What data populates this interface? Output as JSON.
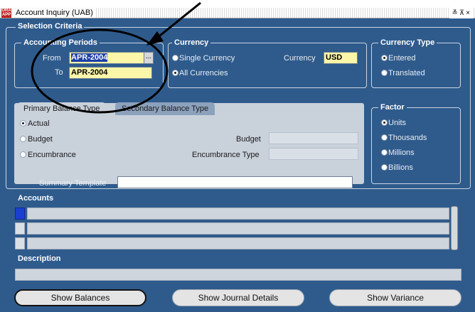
{
  "window": {
    "title": "Account Inquiry (UAB)",
    "controls": "≚⊼×"
  },
  "selection_criteria": {
    "legend": "Selection Criteria",
    "accounting_periods": {
      "legend": "Accounting Periods",
      "from_label": "From",
      "from_value": "APR-2004",
      "to_label": "To",
      "to_value": "APR-2004",
      "lov_button": "..."
    },
    "currency": {
      "legend": "Currency",
      "single_label": "Single Currency",
      "all_label": "All Currencies",
      "currency_label": "Currency",
      "currency_value": "USD",
      "selected": "all"
    },
    "currency_type": {
      "legend": "Currency Type",
      "entered_label": "Entered",
      "translated_label": "Translated",
      "selected": "entered"
    },
    "factor": {
      "legend": "Factor",
      "options": [
        "Units",
        "Thousands",
        "Millions",
        "Billions"
      ],
      "selected": "Units"
    },
    "balance_tabs": {
      "primary_label": "Primary Balance Type",
      "secondary_label": "Secondary Balance Type",
      "active": "primary"
    },
    "balance_type": {
      "actual_label": "Actual",
      "budget_label": "Budget",
      "encumbrance_label": "Encumbrance",
      "budget_field_label": "Budget",
      "encumbrance_type_label": "Encumbrance Type",
      "selected": "actual"
    },
    "summary_template_label": "Summary Template"
  },
  "accounts": {
    "legend": "Accounts",
    "rows": 3
  },
  "description": {
    "legend": "Description"
  },
  "buttons": {
    "show_balances": "Show Balances",
    "show_journal_details": "Show Journal Details",
    "show_variance": "Show Variance"
  },
  "colors": {
    "form_background": "#2f5b8c",
    "required_field": "#fbf6a8",
    "selection": "#1c3fa8"
  }
}
